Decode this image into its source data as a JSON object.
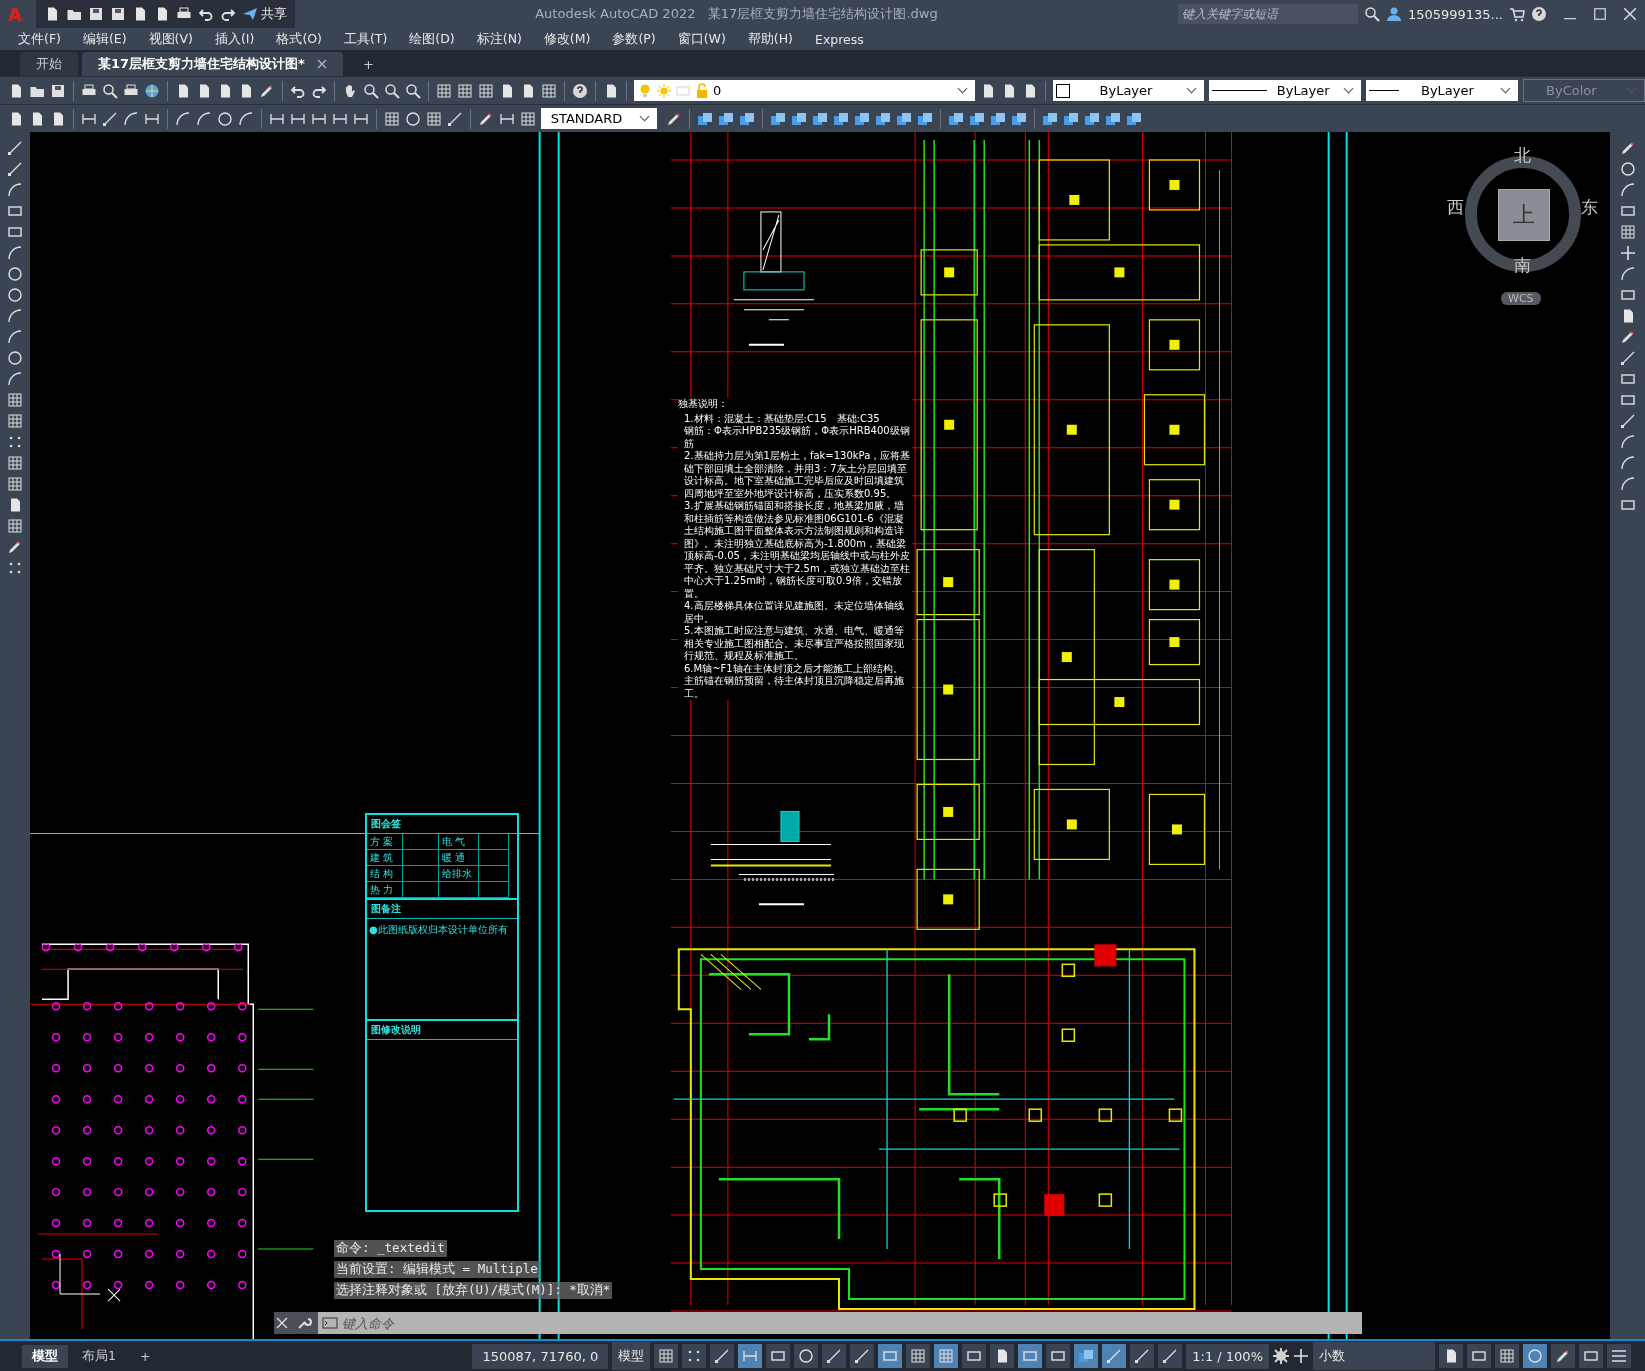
{
  "title_bar": {
    "logo": "A",
    "share": "共享",
    "app_title": "Autodesk AutoCAD 2022",
    "file_title": "某17层框支剪力墙住宅结构设计图.dwg",
    "search_placeholder": "键入关键字或短语",
    "user": "1505999135..."
  },
  "menu": [
    "文件(F)",
    "编辑(E)",
    "视图(V)",
    "插入(I)",
    "格式(O)",
    "工具(T)",
    "绘图(D)",
    "标注(N)",
    "修改(M)",
    "参数(P)",
    "窗口(W)",
    "帮助(H)",
    "Express"
  ],
  "tabs": [
    {
      "label": "开始",
      "selected": false
    },
    {
      "label": "某17层框支剪力墙住宅结构设计图*",
      "selected": true
    }
  ],
  "new_tab": "+",
  "layer": {
    "value": "0"
  },
  "properties": [
    {
      "value": "ByLayer",
      "kind": "color",
      "disabled": false
    },
    {
      "value": "ByLayer",
      "kind": "linetype",
      "disabled": false
    },
    {
      "value": "ByLayer",
      "kind": "lineweight",
      "disabled": false
    },
    {
      "value": "ByColor",
      "kind": "plotstyle",
      "disabled": true
    }
  ],
  "text_style": {
    "value": "STANDARD"
  },
  "viewcube": {
    "north": "北",
    "south": "南",
    "east": "东",
    "west": "西",
    "face": "上",
    "wcs": "WCS"
  },
  "drawing": {
    "notes_title": "独基说明：",
    "notes": [
      "1.材料：混凝土：基础垫层:C15　基础:C35",
      "钢筋：Φ表示HPB235级钢筋，Φ表示HRB400级钢筋",
      "2.基础持力层为第1层粉土，fak=130kPa，应将基础下部回填土全部清除，并用3：7灰土分层回填至设计标高。地下室基础施工完毕后应及时回填建筑四周地坪至室外地坪设计标高，压实系数0.95。",
      "3.扩展基础钢筋锚固和搭接长度，地基梁加腋，墙和柱插筋等构造做法参见标准图06G101-6《混凝土结构施工图平面整体表示方法制图规则和构造详图》。未注明独立基础底标高为-1.800m，基础梁顶标高-0.05，未注明基础梁均居轴线中或与柱外皮平齐。独立基础尺寸大于2.5m，或独立基础边至柱中心大于1.25m时，钢筋长度可取0.9倍，交错放置。",
      "4.高层楼梯具体位置详见建施图。未定位墙体轴线居中。",
      "5.本图施工时应注意与建筑、水通、电气、暖通等相关专业施工图相配合。未尽事宜严格按照国家现行规范、规程及标准施工。",
      "6.M轴~F1轴在主体封顶之后才能施工上部结构。主筋锚在钢筋预留，待主体封顶且沉降稳定后再施工。"
    ],
    "title_block": {
      "sign_title": "图会签",
      "sign_labels": [
        "方 案",
        "电 气",
        "建 筑",
        "暖 通",
        "结 构",
        "给排水",
        "热 力"
      ],
      "remarks_title": "图备注",
      "remark": "●此图纸版权归本设计单位所有",
      "revision_title": "图修改说明"
    }
  },
  "command": {
    "history": [
      "命令: _textedit",
      "当前设置: 编辑模式 = Multiple",
      "选择注释对象或 [放弃(U)/模式(M)]: *取消*"
    ],
    "placeholder": "键入命令"
  },
  "status_bar": {
    "layouts": [
      {
        "label": "模型",
        "selected": true
      },
      {
        "label": "布局1",
        "selected": false
      }
    ],
    "add": "+",
    "coordinates": "150087, 71760, 0",
    "space": "模型",
    "toggles": [
      {
        "on": false
      },
      {
        "on": false
      },
      {
        "on": false
      },
      {
        "on": true
      },
      {
        "on": false
      },
      {
        "on": false
      },
      {
        "on": false
      },
      {
        "on": false
      },
      {
        "on": true
      },
      {
        "on": false
      },
      {
        "on": true
      },
      {
        "on": false
      },
      {
        "on": false
      },
      {
        "on": true
      },
      {
        "on": false
      },
      {
        "on": true
      },
      {
        "on": true
      },
      {
        "on": false
      },
      {
        "on": false
      }
    ],
    "scale": "1:1 / 100%",
    "units": "小数",
    "end_toggles": [
      {
        "on": false
      },
      {
        "on": false
      },
      {
        "on": false
      },
      {
        "on": true
      },
      {
        "on": false
      },
      {
        "on": false
      },
      {
        "on": false
      }
    ]
  }
}
